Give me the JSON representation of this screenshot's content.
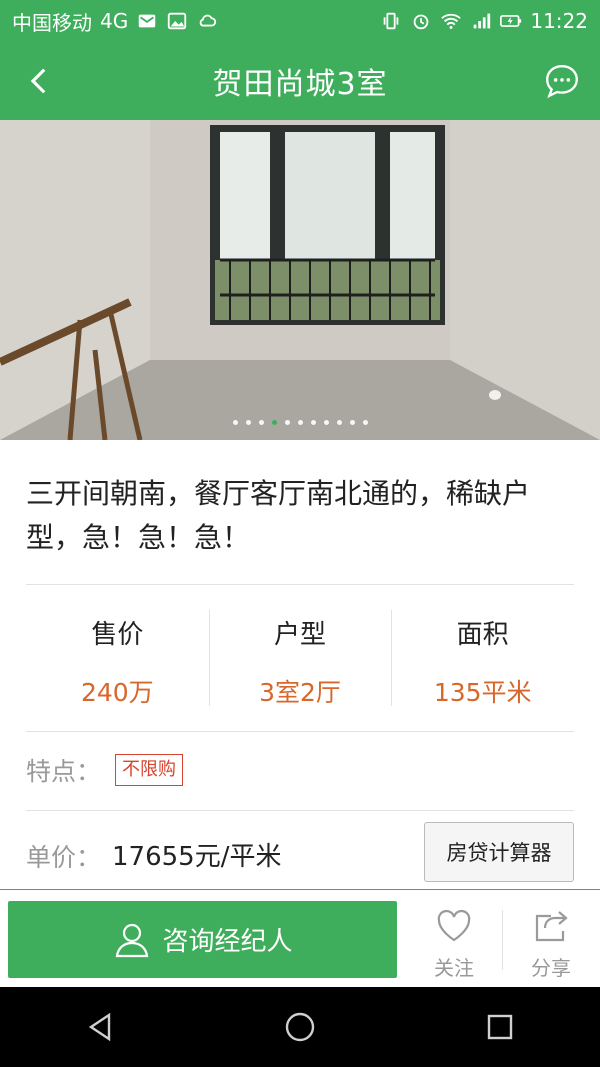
{
  "status_bar": {
    "carrier": "中国移动",
    "network": "4G",
    "time": "11:22",
    "icons_left": [
      "mail-icon",
      "image-icon",
      "cloud-icon"
    ],
    "icons_right": [
      "vibrate-icon",
      "alarm-icon",
      "wifi-icon",
      "signal-4g-icon",
      "battery-icon"
    ]
  },
  "app_bar": {
    "title": "贺田尚城3室",
    "back_icon": "chevron-left-icon",
    "chat_icon": "chat-bubble-icon"
  },
  "gallery": {
    "image": "empty-room-photo",
    "total": 11,
    "current": 4
  },
  "headline": "三开间朝南，餐厅客厅南北通的，稀缺户型，急！急！急！",
  "stats": [
    {
      "label": "售价",
      "value": "240万"
    },
    {
      "label": "户型",
      "value": "3室2厅"
    },
    {
      "label": "面积",
      "value": "135平米"
    }
  ],
  "features": {
    "label": "特点：",
    "tags": [
      "不限购"
    ]
  },
  "unit_price": {
    "label": "单价：",
    "value": "17655元/平米",
    "calc_button": "房贷计算器"
  },
  "actions": {
    "consult": "咨询经纪人",
    "favorite": "关注",
    "share": "分享"
  },
  "colors": {
    "brand_green": "#3fae5c",
    "price_orange": "#d8672b",
    "tag_red": "#d8452f"
  }
}
